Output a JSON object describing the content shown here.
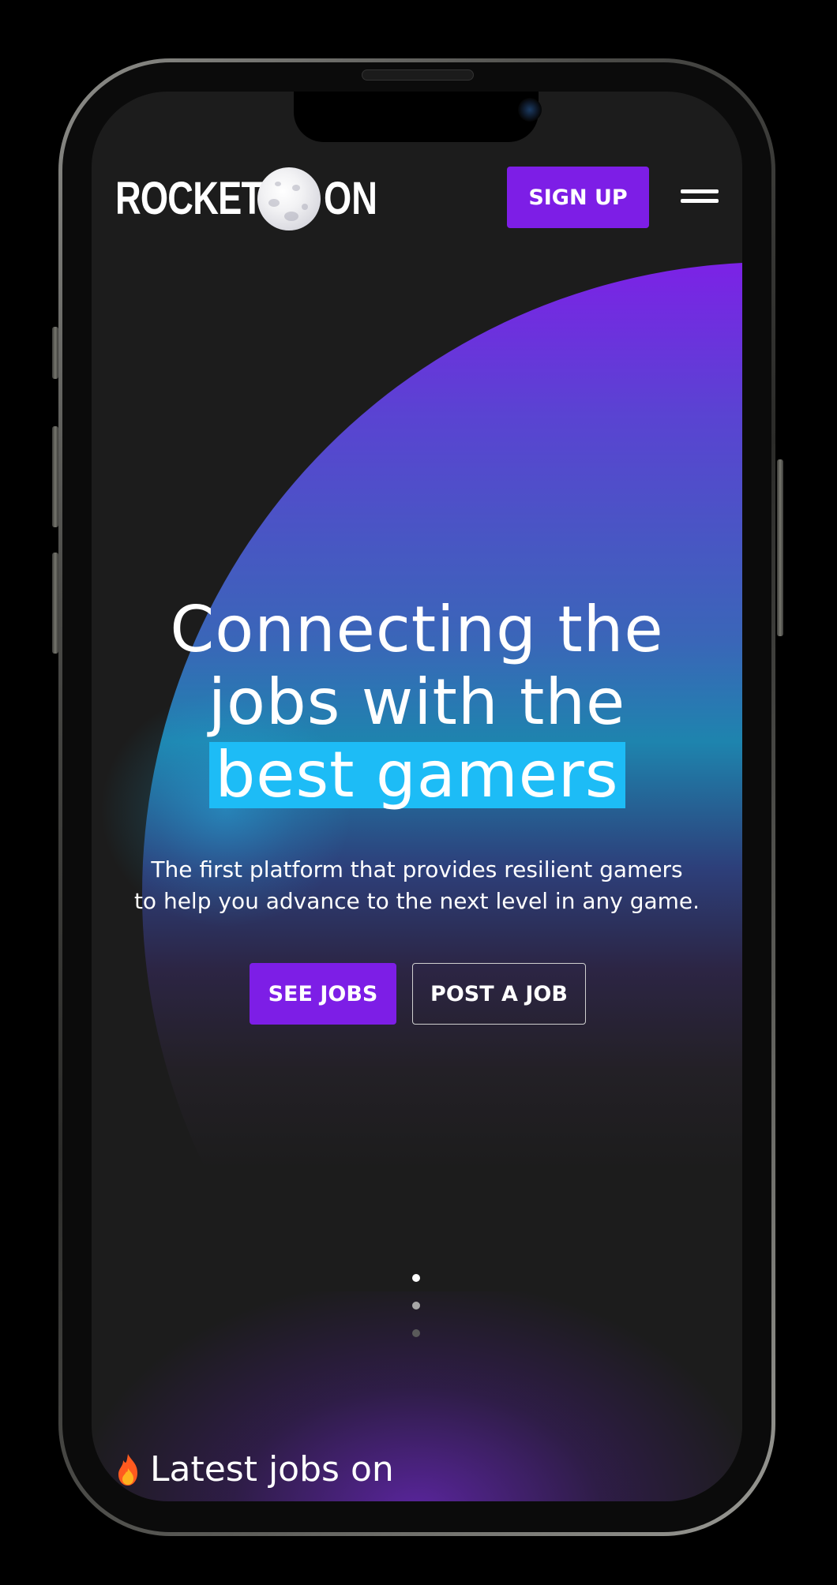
{
  "header": {
    "logo_part1": "ROCKET M",
    "logo_part2": "ON",
    "signup_label": "SIGN UP"
  },
  "hero": {
    "title_line1": "Connecting the",
    "title_line2": "jobs with the",
    "title_highlight": "best gamers",
    "subtitle_line1": "The first platform that provides resilient gamers",
    "subtitle_line2": "to help you advance to the next level in any game.",
    "cta_primary": "SEE JOBS",
    "cta_secondary": "POST A JOB"
  },
  "carousel": {
    "dots": 3,
    "active_index": 0
  },
  "latest": {
    "heading": "Latest jobs on",
    "icon": "flame-icon"
  },
  "colors": {
    "brand_purple": "#7d1ee6",
    "highlight_cyan": "#1dbcf6",
    "background": "#1c1c1c"
  }
}
